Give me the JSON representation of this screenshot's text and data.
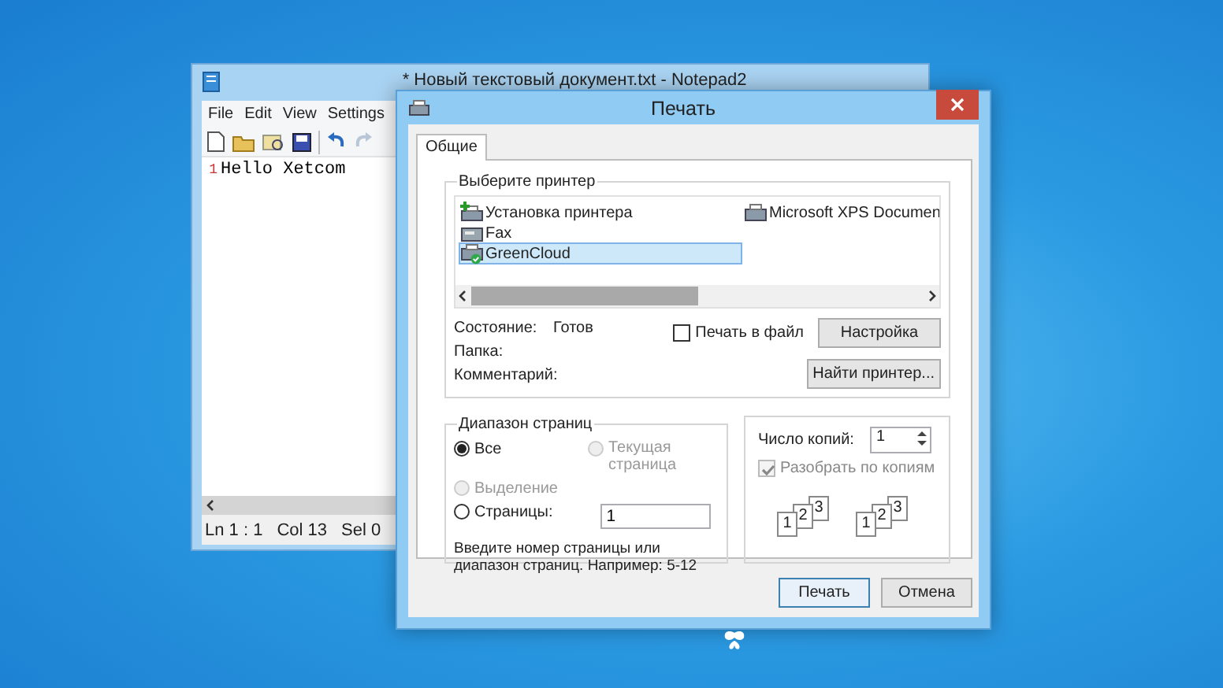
{
  "notepad": {
    "title": "* Новый текстовый документ.txt - Notepad2",
    "menu": [
      "File",
      "Edit",
      "View",
      "Settings"
    ],
    "lines": [
      {
        "number": "1",
        "text": "Hello Xetcom"
      }
    ],
    "status_bar": [
      "Ln 1 : 1",
      "Col 13",
      "Sel 0"
    ]
  },
  "dialog": {
    "title": "Печать",
    "tabs": [
      {
        "label": "Общие",
        "selected": true
      }
    ],
    "printer_group": {
      "title": "Выберите принтер",
      "printers": [
        {
          "name": "Установка принтера",
          "kind": "add",
          "selected": false
        },
        {
          "name": "Fax",
          "kind": "fax",
          "selected": false
        },
        {
          "name": "GreenCloud",
          "kind": "default",
          "selected": true
        },
        {
          "name": "Microsoft XPS Documen",
          "kind": "printer",
          "selected": false
        }
      ],
      "info": [
        {
          "label": "Состояние:",
          "value": "Готов"
        },
        {
          "label": "Папка:"
        },
        {
          "label": "Комментарий:"
        }
      ],
      "print_to_file": {
        "label": "Печать в файл",
        "checked": false
      },
      "buttons": [
        "Настройка",
        "Найти принтер..."
      ]
    },
    "page_range": {
      "title": "Диапазон страниц",
      "options": [
        {
          "label": "Все",
          "selected": true,
          "disabled": false
        },
        {
          "label": "Текущая страница",
          "selected": false,
          "disabled": true
        },
        {
          "label": "Выделение",
          "selected": false,
          "disabled": true
        },
        {
          "label": "Страницы:",
          "selected": false,
          "disabled": false
        }
      ],
      "pages_value": "1",
      "hint": "Введите номер страницы или диапазон страниц.  Например: 5-12"
    },
    "copies": {
      "label": "Число копий:",
      "value": "1",
      "collate": {
        "label": "Разобрать по копиям",
        "checked": true,
        "disabled": true
      },
      "illustration": [
        [
          "1",
          "2",
          "3"
        ],
        [
          "1",
          "2",
          "3"
        ]
      ]
    },
    "buttons": [
      "Печать",
      "Отмена"
    ]
  }
}
